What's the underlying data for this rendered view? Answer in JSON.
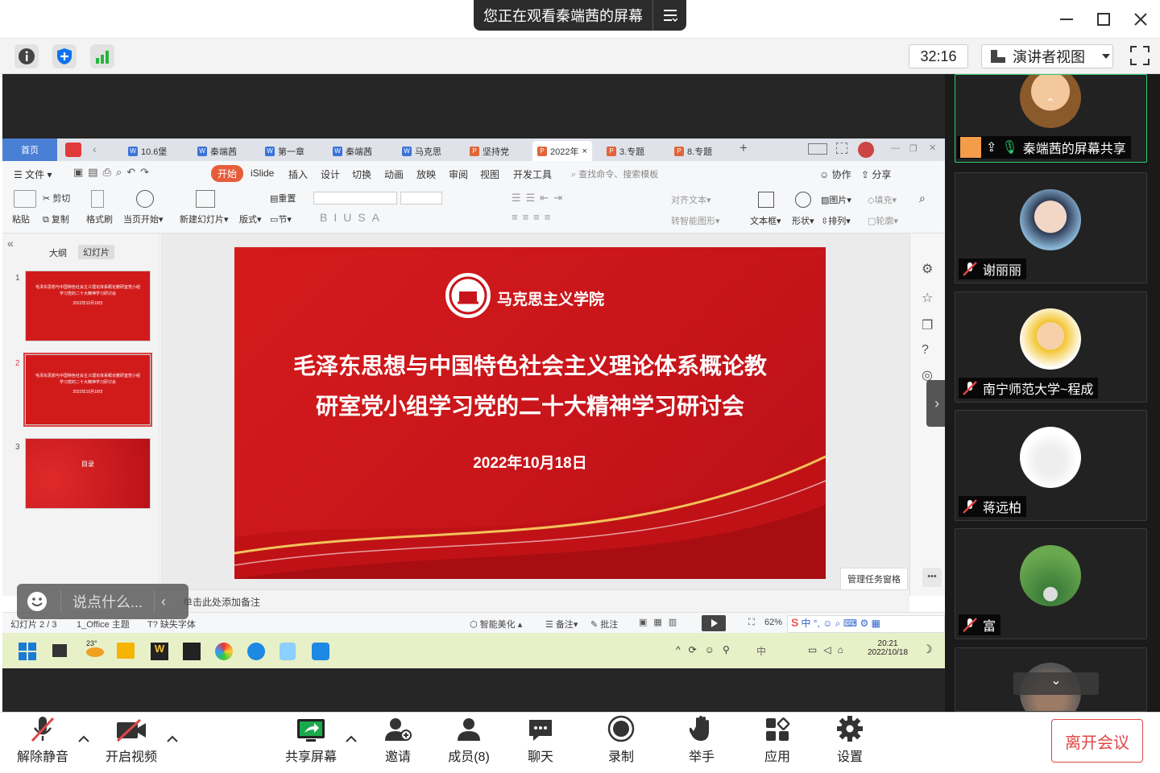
{
  "title_bar": {
    "share_banner": "您正在观看秦端茜的屏幕"
  },
  "toolbar": {
    "timer": "32:16",
    "view_label": "演讲者视图"
  },
  "wps": {
    "tabs": [
      {
        "label": "首页"
      },
      {
        "label": "10.6堡"
      },
      {
        "label": "秦端茜"
      },
      {
        "label": "第一章"
      },
      {
        "label": "秦端茜"
      },
      {
        "label": "马克思"
      },
      {
        "label": "坚持党"
      },
      {
        "label": "2022年"
      },
      {
        "label": "3.专题"
      },
      {
        "label": "8.专题"
      }
    ],
    "menu": [
      "文件",
      "开始",
      "iSlide",
      "插入",
      "设计",
      "切换",
      "动画",
      "放映",
      "审阅",
      "视图",
      "开发工具"
    ],
    "search_placeholder": "查找命令、搜索模板",
    "collab": "协作",
    "share": "分享",
    "ribbon": {
      "paste": "粘贴",
      "cut": "剪切",
      "copy": "复制",
      "format_painter": "格式刷",
      "from_current": "当页开始",
      "new_slide": "新建幻灯片",
      "layout": "版式",
      "reset": "重置",
      "section": "节",
      "align_text": "对齐文本",
      "smart_shape": "转智能图形",
      "textbox": "文本框",
      "shape": "形状",
      "picture": "图片",
      "arrange": "排列",
      "fill": "填充",
      "outline": "轮廓"
    },
    "pane_tabs": [
      "大纲",
      "幻灯片"
    ],
    "thumbs": [
      {
        "num": "1",
        "title": "毛泽东思想与中国特色社会主义理论体系概论教研室党小组学习党的二十大精神学习研讨会",
        "date": "2022年10月18日"
      },
      {
        "num": "2",
        "title": "毛泽东思想与中国特色社会主义理论体系概论教研室党小组学习党的二十大精神学习研讨会",
        "date": "2022年10月18日"
      },
      {
        "num": "3",
        "title": "目录"
      }
    ],
    "slide": {
      "org": "马克思主义学院",
      "title_line1": "毛泽东思想与中国特色社会主义理论体系概论教",
      "title_line2": "研室党小组学习党的二十大精神学习研讨会",
      "date": "2022年10月18日"
    },
    "notes_placeholder": "单击此处添加备注",
    "task_pane_tip": "管理任务窗格",
    "status": {
      "slide": "幻灯片 2 / 3",
      "theme": "1_Office 主题",
      "font": "缺失字体",
      "beautify": "智能美化",
      "notes": "备注",
      "comment": "批注",
      "zoom": "62%"
    },
    "taskbar": {
      "weather": "23°",
      "ime": "中",
      "time": "20:21",
      "date": "2022/10/18"
    }
  },
  "chat_input": {
    "placeholder": "说点什么..."
  },
  "participants": [
    {
      "name": "秦端茜的屏幕共享"
    },
    {
      "name": "谢丽丽"
    },
    {
      "name": "南宁师范大学~程成"
    },
    {
      "name": "蒋远柏"
    },
    {
      "name": "富"
    }
  ],
  "bottom_bar": {
    "unmute": "解除静音",
    "start_video": "开启视频",
    "share_screen": "共享屏幕",
    "invite": "邀请",
    "members": "成员(8)",
    "chat": "聊天",
    "record": "录制",
    "raise_hand": "举手",
    "apps": "应用",
    "settings": "设置",
    "leave": "离开会议"
  },
  "colors": {
    "accent": "#0e72ed",
    "leave": "#e04646",
    "slide_red": "#d41b1b",
    "wps_tab_active": "#d63d3d"
  }
}
